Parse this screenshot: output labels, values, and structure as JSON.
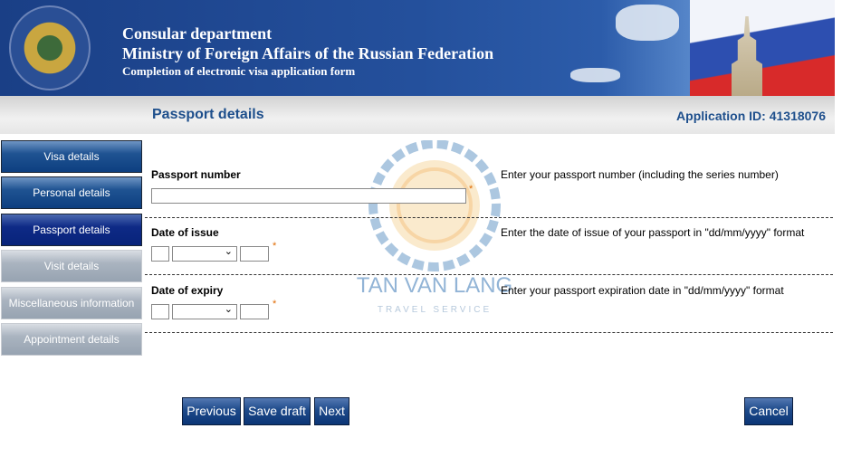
{
  "header": {
    "line1": "Consular department",
    "line2": "Ministry of Foreign Affairs of the Russian Federation",
    "line3": "Completion of electronic visa application form"
  },
  "section_title": "Passport details",
  "application_id": "Application ID: 41318076",
  "sidebar": {
    "items": [
      {
        "label": "Visa details",
        "state": "completed"
      },
      {
        "label": "Personal details",
        "state": "completed"
      },
      {
        "label": "Passport details",
        "state": "active"
      },
      {
        "label": "Visit details",
        "state": "disabled"
      },
      {
        "label": "Miscellaneous information",
        "state": "disabled"
      },
      {
        "label": "Appointment details",
        "state": "disabled"
      }
    ]
  },
  "form": {
    "passport_number": {
      "label": "Passport number",
      "value": "",
      "hint": "Enter your passport number (including the series number)",
      "required_mark": "*"
    },
    "date_of_issue": {
      "label": "Date of issue",
      "day": "",
      "month": "",
      "year": "",
      "hint": "Enter the date of issue of your passport in \"dd/mm/yyyy\" format",
      "required_mark": "*"
    },
    "date_of_expiry": {
      "label": "Date of expiry",
      "day": "",
      "month": "",
      "year": "",
      "hint": "Enter your passport expiration date in \"dd/mm/yyyy\" format",
      "required_mark": "*"
    }
  },
  "buttons": {
    "previous": "Previous",
    "save_draft": "Save draft",
    "next": "Next",
    "cancel": "Cancel"
  },
  "watermark": {
    "name": "TAN VAN LANG",
    "tagline": "TRAVEL SERVICE"
  },
  "colors": {
    "accent": "#1e4f8c",
    "required": "#e06a00"
  }
}
